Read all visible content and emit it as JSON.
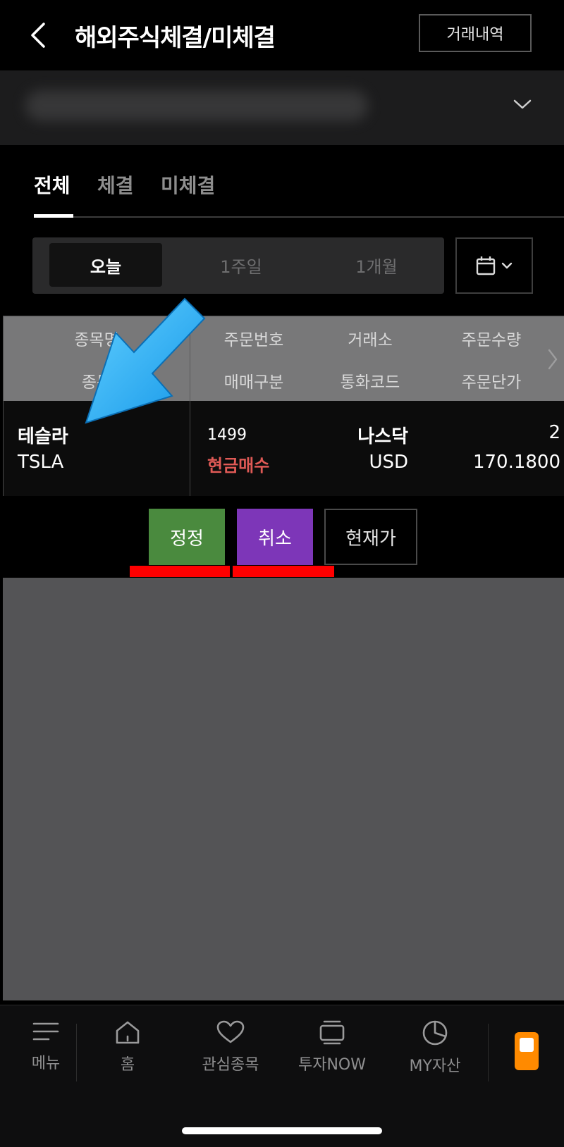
{
  "header": {
    "title": "해외주식체결/미체결",
    "history_button": "거래내역"
  },
  "tabs": [
    "전체",
    "체결",
    "미체결"
  ],
  "period": {
    "options": [
      "오늘",
      "1주일",
      "1개월"
    ],
    "selected": "오늘"
  },
  "table": {
    "header_row1": [
      "종목명",
      "주문번호",
      "거래소",
      "주문수량"
    ],
    "header_row2": [
      "종목",
      "매매구분",
      "통화코드",
      "주문단가"
    ],
    "rows": [
      {
        "name": "테슬라",
        "ticker": "TSLA",
        "order_no": "1499",
        "side": "현금매수",
        "exchange": "나스닥",
        "currency": "USD",
        "qty": "2",
        "price": "170.1800"
      }
    ]
  },
  "actions": {
    "edit": "정정",
    "cancel": "취소",
    "price": "현재가"
  },
  "nav": {
    "items": [
      "메뉴",
      "홈",
      "관심종목",
      "투자NOW",
      "MY자산"
    ]
  },
  "colors": {
    "buy": "#e05a56",
    "edit_btn": "#4a8a3e",
    "cancel_btn": "#7d36b8",
    "highlight_mark": "#ff0000",
    "arrow": "#1ea6f2"
  },
  "icons": [
    "back-icon",
    "chevron-down-icon",
    "calendar-icon",
    "chevron-right-icon",
    "menu-icon",
    "home-icon",
    "heart-icon",
    "stack-icon",
    "pie-chart-icon",
    "phone-icon"
  ]
}
